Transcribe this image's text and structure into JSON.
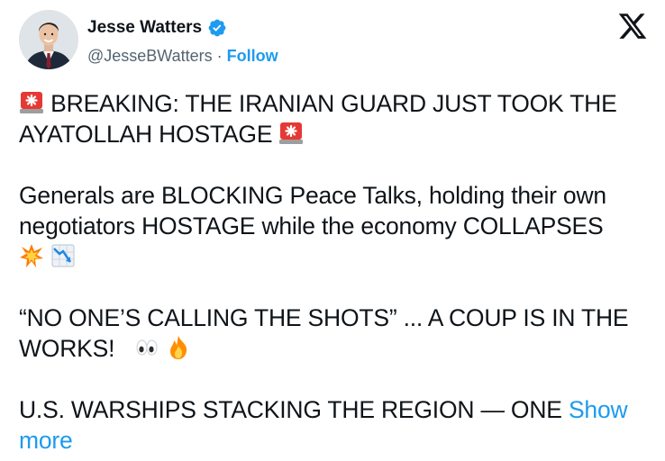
{
  "author": {
    "display_name": "Jesse Watters",
    "handle": "@JesseBWatters",
    "separator": "·",
    "follow_label": "Follow"
  },
  "brand": {
    "logo": "x-logo-icon"
  },
  "tweet": {
    "p1_text": "BREAKING: THE IRANIAN GUARD JUST TOOK THE AYATOLLAH HOSTAGE",
    "p2_text": "Generals are BLOCKING Peace Talks, holding their own negotiators HOSTAGE while the economy COLLAPSES",
    "p3_text": "“NO ONE’S CALLING THE SHOTS” ... A COUP IS IN THE WORKS!",
    "p4_text": "U.S. WARSHIPS STACKING THE REGION — ONE",
    "show_more_label": "Show more"
  },
  "emojis": {
    "siren": "police-light-emoji",
    "collision": "collision-emoji",
    "chart_down": "chart-decreasing-emoji",
    "eyes": "eyes-emoji",
    "fire": "fire-emoji"
  },
  "colors": {
    "accent": "#1d9bf0",
    "text": "#0f1419",
    "secondary": "#536471"
  }
}
